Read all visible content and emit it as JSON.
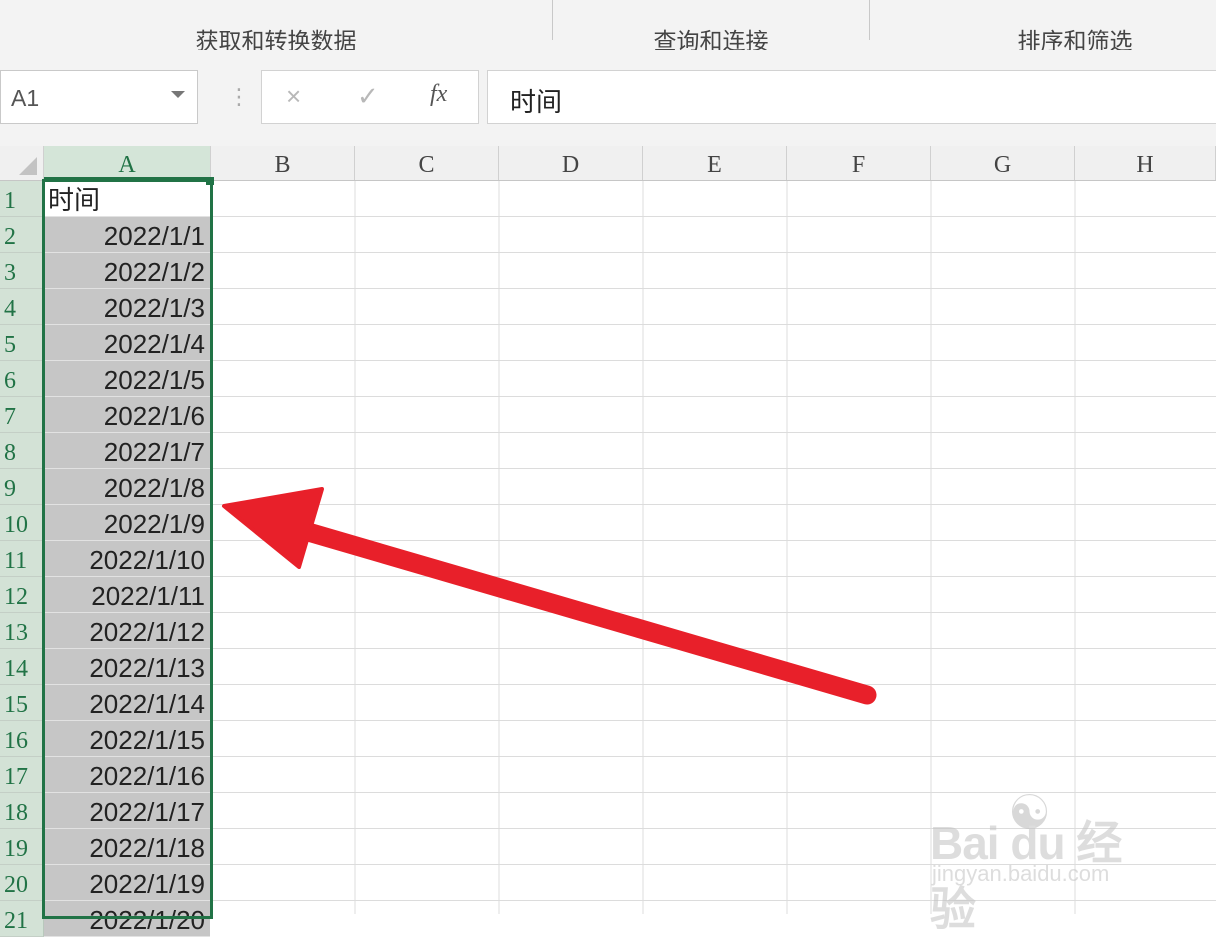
{
  "ribbon": {
    "groups": [
      "获取和转换数据",
      "查询和连接",
      "排序和筛选"
    ]
  },
  "formula_bar": {
    "name_box": "A1",
    "cancel_icon": "×",
    "enter_icon": "✓",
    "fx_label": "fx",
    "formula": "时间",
    "grip": "⋮"
  },
  "sheet": {
    "columns": [
      "A",
      "B",
      "C",
      "D",
      "E",
      "F",
      "G",
      "H"
    ],
    "rows": [
      "1",
      "2",
      "3",
      "4",
      "5",
      "6",
      "7",
      "8",
      "9",
      "10",
      "11",
      "12",
      "13",
      "14",
      "15",
      "16",
      "17",
      "18",
      "19",
      "20",
      "21"
    ],
    "column_a": [
      "时间",
      "2022/1/1",
      "2022/1/2",
      "2022/1/3",
      "2022/1/4",
      "2022/1/5",
      "2022/1/6",
      "2022/1/7",
      "2022/1/8",
      "2022/1/9",
      "2022/1/10",
      "2022/1/11",
      "2022/1/12",
      "2022/1/13",
      "2022/1/14",
      "2022/1/15",
      "2022/1/16",
      "2022/1/17",
      "2022/1/18",
      "2022/1/19",
      "2022/1/20"
    ],
    "selected_column": "A",
    "selection_color": "#217346",
    "arrow_color": "#e8202a"
  },
  "watermark": {
    "brand": "Bai du 经验",
    "url": "jingyan.baidu.com"
  }
}
